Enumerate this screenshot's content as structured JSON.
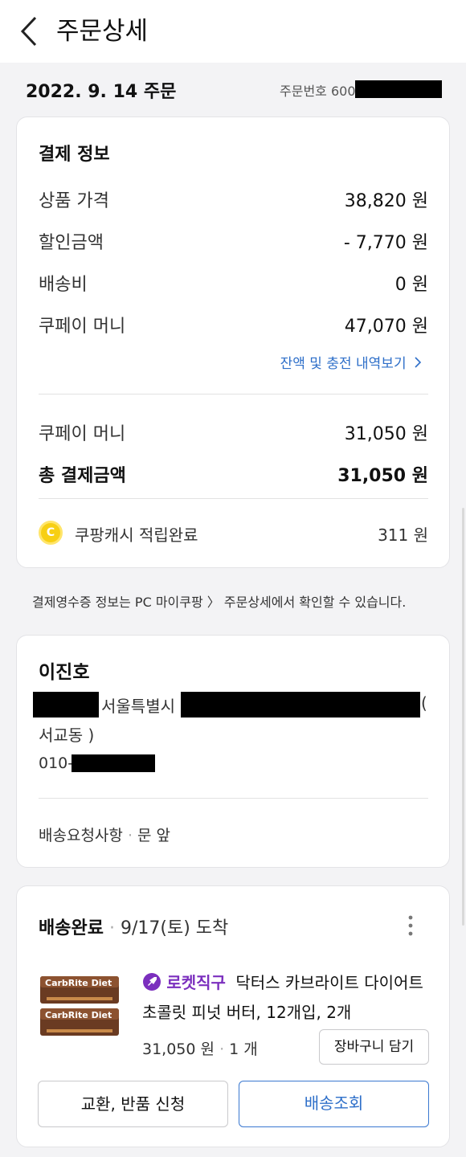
{
  "header": {
    "title": "주문상세"
  },
  "order": {
    "date": "2022. 9. 14 주문",
    "order_no_label": "주문번호 600"
  },
  "payment": {
    "title": "결제 정보",
    "rows": [
      {
        "label": "상품 가격",
        "value": "38,820 원"
      },
      {
        "label": "할인금액",
        "value": "- 7,770 원"
      },
      {
        "label": "배송비",
        "value": "0 원"
      },
      {
        "label": "쿠페이 머니",
        "value": "47,070 원"
      }
    ],
    "history_link": "잔액 및 충전 내역보기",
    "paid_label": "쿠페이 머니",
    "paid_value": "31,050 원",
    "total_label": "총 결제금액",
    "total_value": "31,050 원",
    "cash_coin": "C",
    "cash_label": "쿠팡캐시 적립완료",
    "cash_value": "311 원"
  },
  "receipt_note": "결제영수증 정보는 PC 마이쿠팡 〉 주문상세에서 확인할 수 있습니다.",
  "shipping": {
    "name": "이진호",
    "address_city": "서울특별시",
    "address_paren": "(",
    "address_dong": "서교동 )",
    "phone_prefix": "010-",
    "request_label": "배송요청사항",
    "request_sep": "·",
    "request_value": "문 앞"
  },
  "delivery": {
    "status": "배송완료",
    "sep": "·",
    "arrival": "9/17(토) 도착",
    "badge": "로켓직구",
    "product_name_line1": "닥터스 카브라이트 다이어트",
    "product_name_line2": "초콜릿 피넛 버터, 12개입, 2개",
    "price": "31,050 원",
    "qty": "1 개",
    "product_image_text": "CarbRite Diet",
    "cart_button": "장바구니 담기",
    "return_button": "교환, 반품 신청",
    "track_button": "배송조회"
  },
  "colors": {
    "accent_blue": "#2e6fc9",
    "badge_purple": "#7b2fbe",
    "coin_yellow": "#f7cf13"
  }
}
